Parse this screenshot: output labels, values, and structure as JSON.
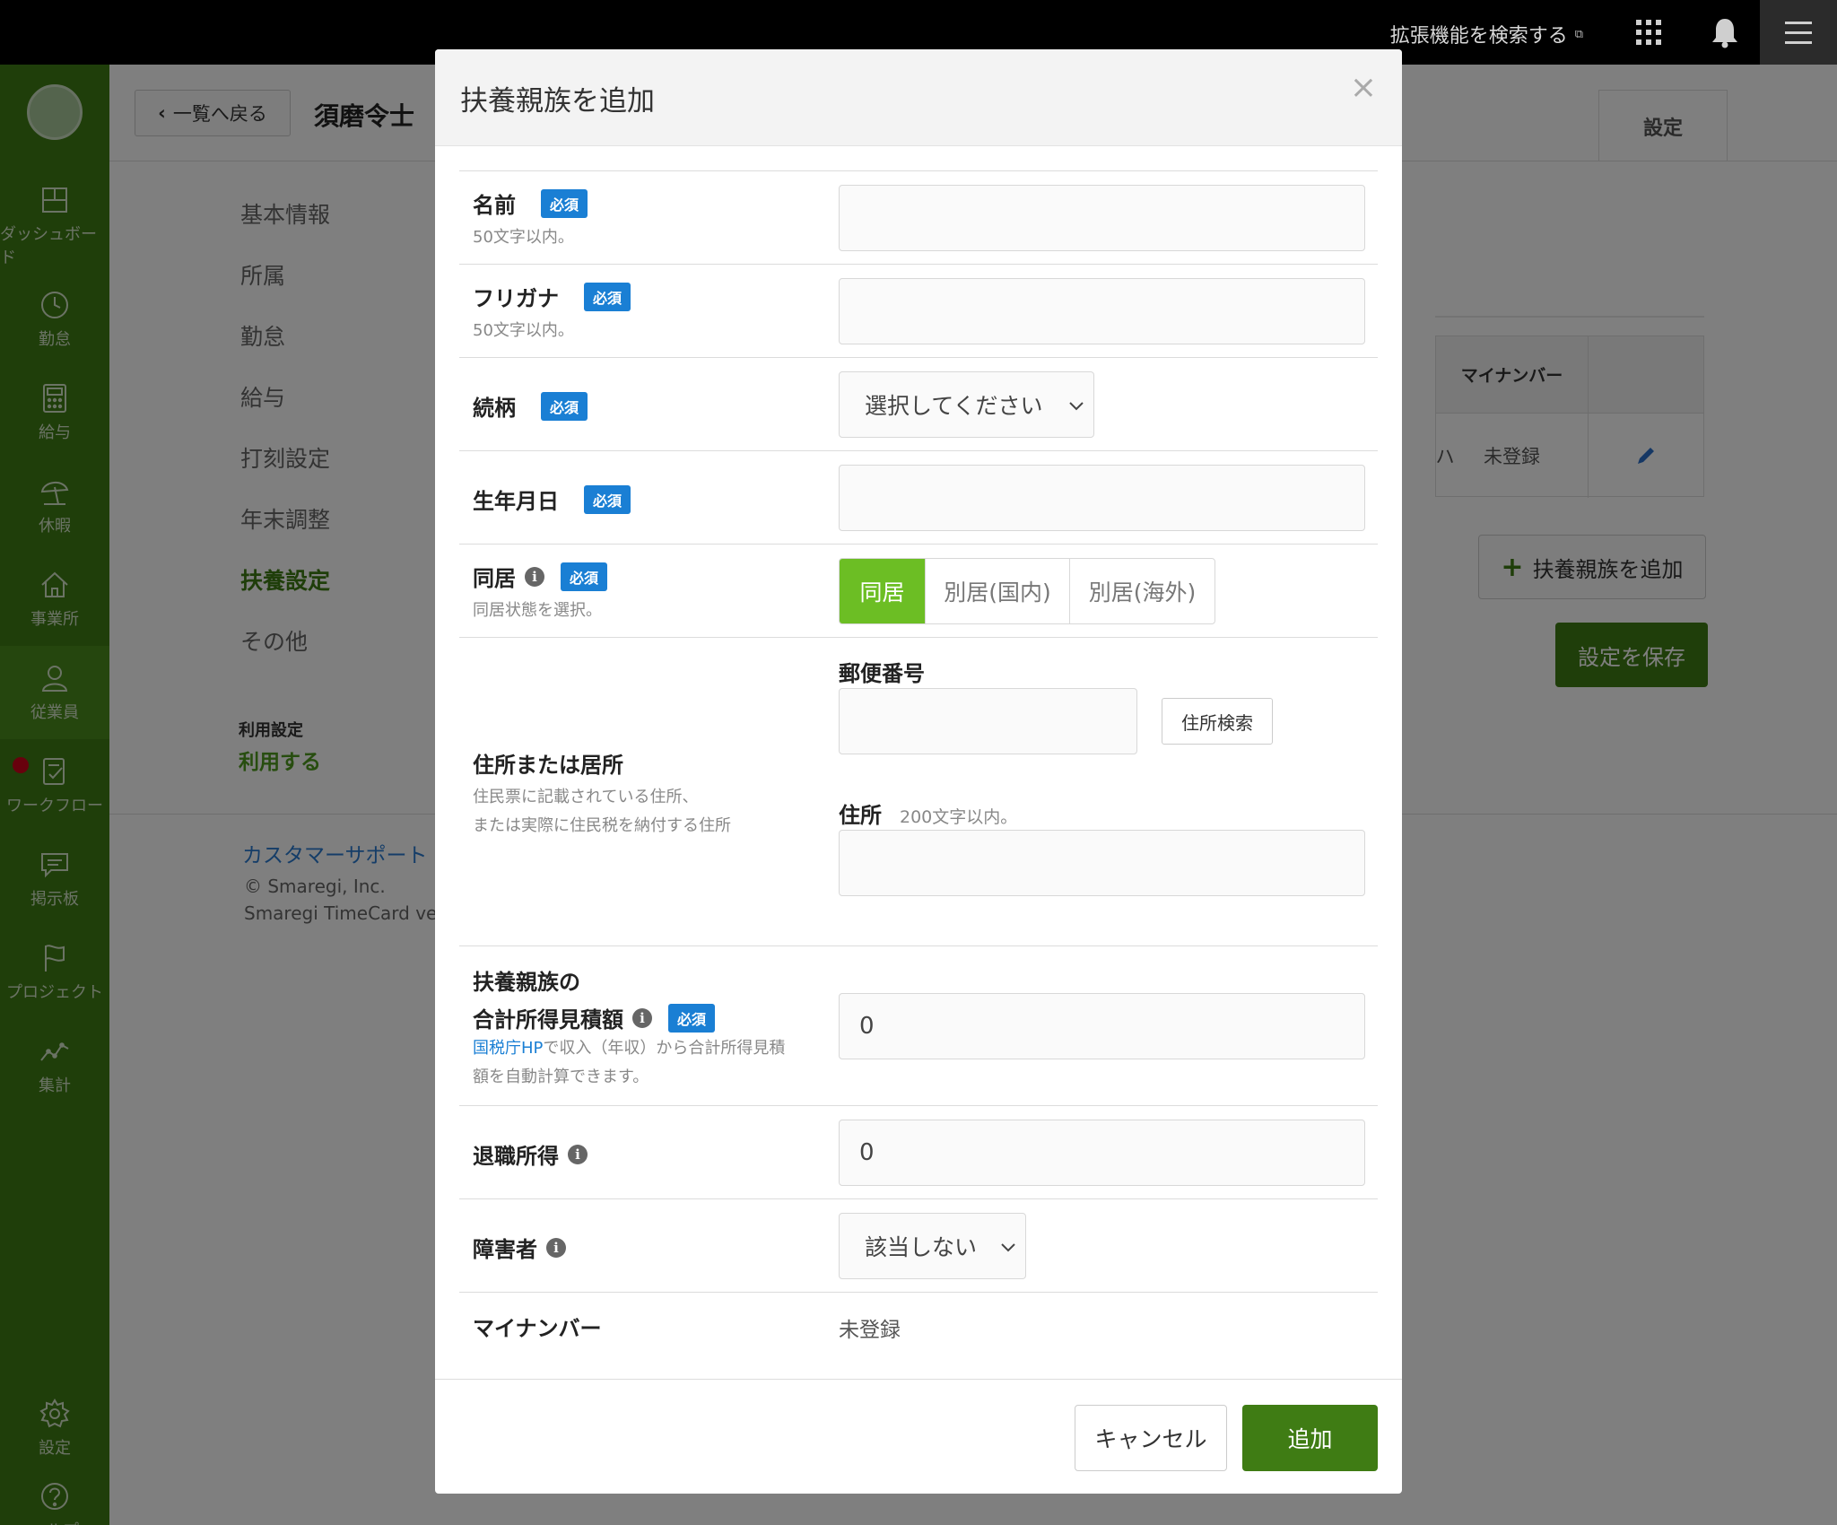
{
  "topbar": {
    "extension_search": "拡張機能を検索する",
    "icons": [
      "external-link-icon",
      "apps-grid-icon",
      "bell-icon",
      "hamburger-menu-icon"
    ]
  },
  "sidebar": {
    "items": [
      {
        "label": "ダッシュボード",
        "icon": "dashboard-icon"
      },
      {
        "label": "勤怠",
        "icon": "clock-icon"
      },
      {
        "label": "給与",
        "icon": "calculator-icon"
      },
      {
        "label": "休暇",
        "icon": "parasol-icon"
      },
      {
        "label": "事業所",
        "icon": "house-icon"
      },
      {
        "label": "従業員",
        "icon": "person-icon",
        "active": true
      },
      {
        "label": "ワークフロー",
        "icon": "checklist-icon",
        "notification": true
      },
      {
        "label": "掲示板",
        "icon": "chat-bubble-icon"
      },
      {
        "label": "プロジェクト",
        "icon": "flag-icon"
      },
      {
        "label": "集計",
        "icon": "line-chart-icon"
      }
    ],
    "bottom_items": [
      {
        "label": "設定",
        "icon": "gear-icon"
      },
      {
        "label": "ヘルプ",
        "icon": "question-icon"
      }
    ]
  },
  "page": {
    "back_label": "一覧へ戻る",
    "employee_name": "須磨令士",
    "settings_tab": "設定",
    "menu": [
      "基本情報",
      "所属",
      "勤怠",
      "給与",
      "打刻設定",
      "年末調整",
      "扶養設定",
      "その他"
    ],
    "active_menu": "扶養設定",
    "usage_label": "利用設定",
    "usage_value": "利用する",
    "support_link": "カスタマーサポート",
    "copyright": "© Smaregi, Inc.",
    "version": "Smaregi TimeCard ve",
    "table": {
      "header_mynumber": "マイナンバー",
      "cell_partial": "ハ",
      "cell_mynumber": "未登録"
    },
    "add_dependent_label": "扶養親族を追加",
    "save_label": "設定を保存"
  },
  "modal": {
    "title": "扶養親族を追加",
    "close": "×",
    "required_badge": "必須",
    "name": {
      "label": "名前",
      "hint": "50文字以内。",
      "value": ""
    },
    "furigana": {
      "label": "フリガナ",
      "hint": "50文字以内。",
      "value": ""
    },
    "relationship": {
      "label": "続柄",
      "selected": "選択してください"
    },
    "birthdate": {
      "label": "生年月日",
      "value": ""
    },
    "cohabitation": {
      "label": "同居",
      "hint": "同居状態を選択。",
      "options": [
        "同居",
        "別居(国内)",
        "別居(海外)"
      ],
      "selected": "同居"
    },
    "address": {
      "label": "住所または居所",
      "hint_line1": "住民票に記載されている住所、",
      "hint_line2": "または実際に住民税を納付する住所",
      "zip_label": "郵便番号",
      "zip_value": "",
      "zip_search": "住所検索",
      "address_label": "住所",
      "address_hint": "200文字以内。",
      "address_value": ""
    },
    "income": {
      "label_line1": "扶養親族の",
      "label_line2": "合計所得見積額",
      "hint_link": "国税庁HP",
      "hint_text1": "で収入（年収）から合計所得見積",
      "hint_text2": "額を自動計算できます。",
      "value": "0"
    },
    "retirement": {
      "label": "退職所得",
      "value": "0"
    },
    "disability": {
      "label": "障害者",
      "selected": "該当しない"
    },
    "mynumber": {
      "label": "マイナンバー",
      "value": "未登録"
    },
    "cancel_label": "キャンセル",
    "add_label": "追加"
  },
  "colors": {
    "sidebar_green": "#3f7c14",
    "primary_button": "#3f7c14",
    "segment_active": "#6cbe24",
    "required_badge": "#1a7fd4",
    "link": "#1a7fd4"
  }
}
